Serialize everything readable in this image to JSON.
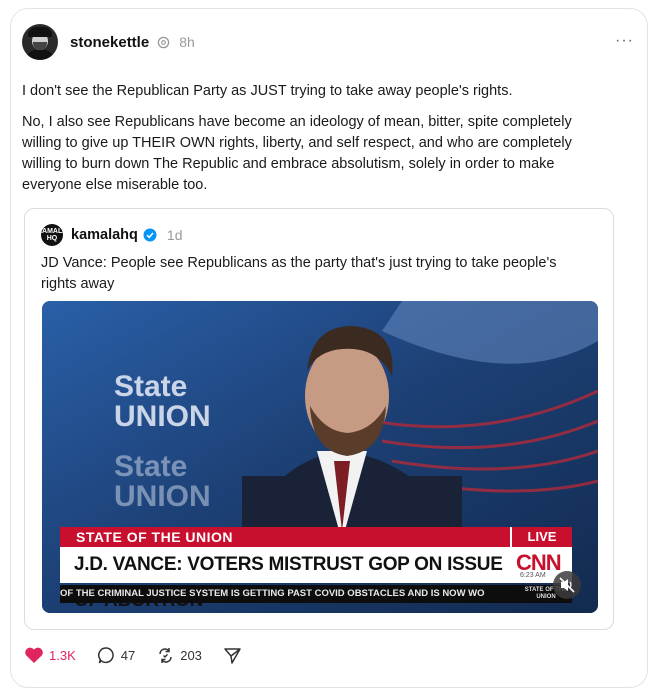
{
  "post": {
    "author": "stonekettle",
    "time": "8h",
    "more_label": "···",
    "paragraphs": [
      "I don't see the Republican Party as JUST trying to take away people's rights.",
      "No, I also see Republicans have become an ideology of mean, bitter, spite completely willing to give up THEIR OWN rights, liberty, and self respect, and who are completely willing to burn down The Republic and embrace absolutism, solely in order to make everyone else miserable too."
    ]
  },
  "quote": {
    "author": "kamalahq",
    "avatar_text": "KAMALA HQ",
    "time": "1d",
    "text": "JD Vance: People see Republicans as the party that's just trying to take people's rights away",
    "video": {
      "background_text_1": "State of the UNION",
      "chyron_title": "STATE OF THE UNION",
      "live_label": "LIVE",
      "chyron_main": "J.D. VANCE: VOTERS MISTRUST GOP ON ISSUE OF ABORTION",
      "network": "CNN",
      "clock": "6:23 AM",
      "ticker": "OF THE CRIMINAL JUSTICE SYSTEM IS GETTING PAST COVID OBSTACLES AND IS NOW WO",
      "ticker_brand": "STATE OF THE UNION"
    }
  },
  "actions": {
    "likes": "1.3K",
    "replies": "47",
    "reposts": "203"
  },
  "colors": {
    "like": "#e0245e",
    "verified": "#0095f6",
    "cnn_red": "#c8102e"
  }
}
